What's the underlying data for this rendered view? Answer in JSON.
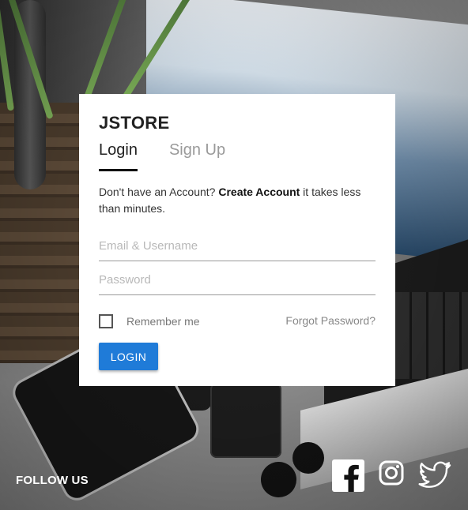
{
  "brand": "JSTORE",
  "tabs": [
    {
      "label": "Login",
      "active": true
    },
    {
      "label": "Sign Up",
      "active": false
    }
  ],
  "description": {
    "before": "Don't have an Account? ",
    "link": "Create Account",
    "after": " it takes less than minutes."
  },
  "form": {
    "email_placeholder": "Email & Username",
    "email_value": "",
    "password_placeholder": "Password",
    "password_value": "",
    "remember_label": "Remember me",
    "remember_checked": false,
    "forgot_label": "Forgot Password?",
    "submit_label": "LOGIN"
  },
  "footer": {
    "follow_label": "FOLLOW US",
    "social_icons": [
      "facebook-icon",
      "instagram-icon",
      "twitter-icon"
    ]
  },
  "colors": {
    "primary_button": "#1f7bd8",
    "card_background": "#ffffff",
    "active_tab_underline": "#111111"
  }
}
